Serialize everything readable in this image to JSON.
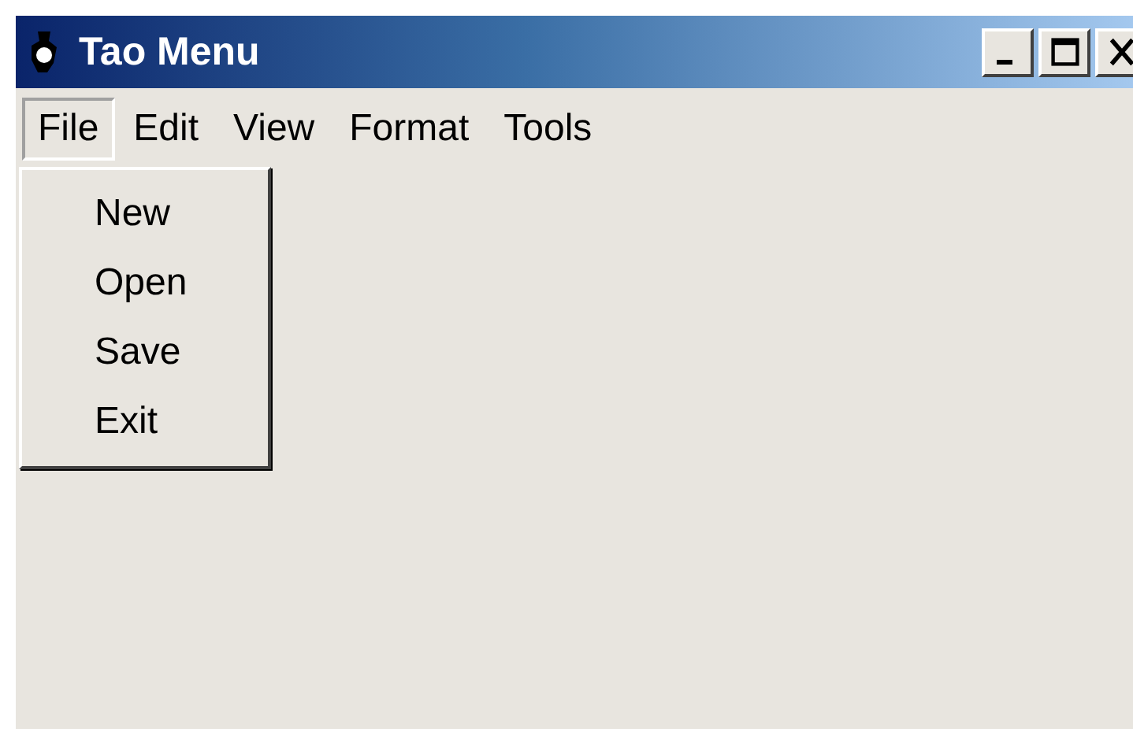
{
  "window": {
    "title": "Tao Menu"
  },
  "menu_bar": [
    {
      "label": "File",
      "selected": true
    },
    {
      "label": "Edit",
      "selected": false
    },
    {
      "label": "View",
      "selected": false
    },
    {
      "label": "Format",
      "selected": false
    },
    {
      "label": "Tools",
      "selected": false
    }
  ],
  "dropdown": {
    "items": [
      "New",
      "Open",
      "Save",
      "Exit"
    ]
  }
}
